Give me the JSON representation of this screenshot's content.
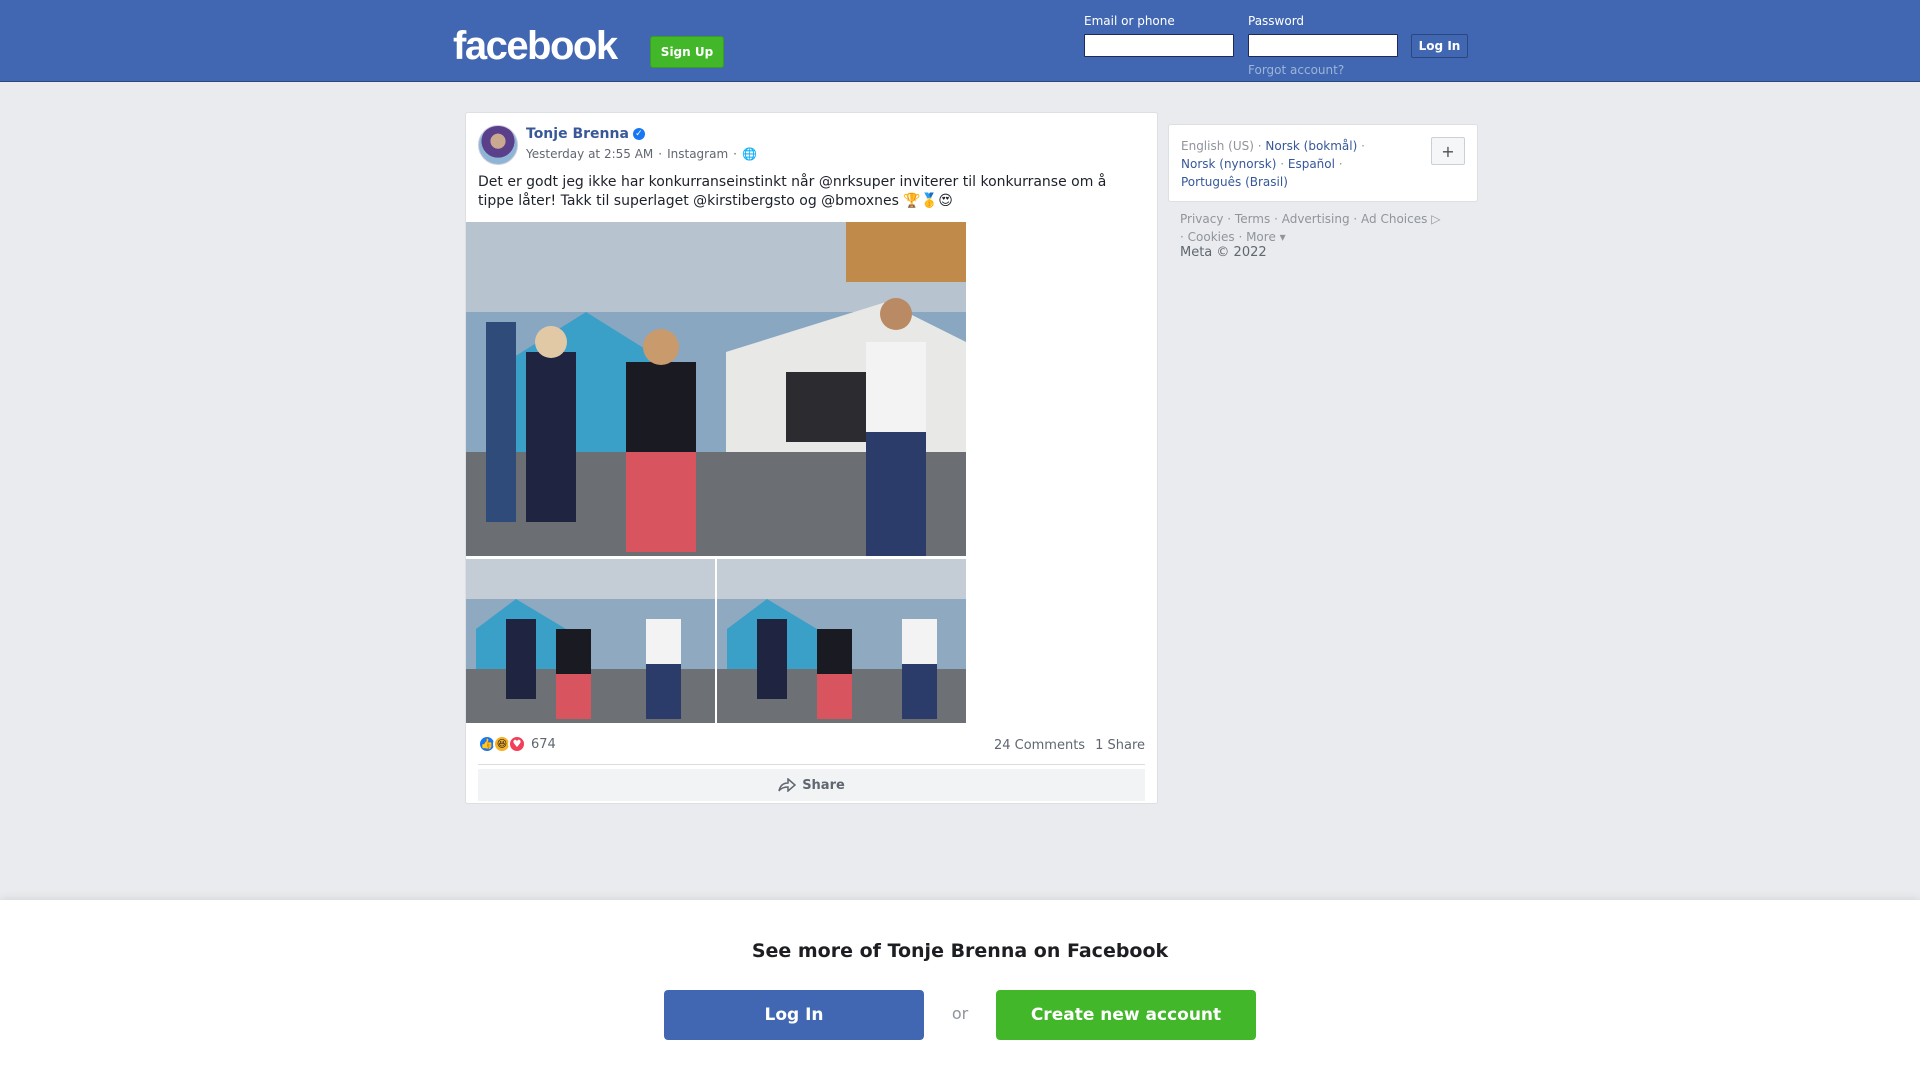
{
  "header": {
    "logo": "facebook",
    "signup_label": "Sign Up",
    "email_label": "Email or phone",
    "password_label": "Password",
    "login_label": "Log In",
    "forgot_label": "Forgot account?"
  },
  "post": {
    "author": "Tonje Brenna",
    "timestamp": "Yesterday at 2:55 AM",
    "source": "Instagram",
    "text": "Det er godt jeg ikke har konkurranseinstinkt når @nrksuper inviterer til konkurranse om å tippe låter! Takk til superlaget @kirstibergsto og @bmoxnes 🏆🥇😍",
    "reactions_count": "674",
    "comments": "24 Comments",
    "shares": "1 Share",
    "share_label": "Share",
    "icons": [
      "avatar",
      "verified-badge-icon",
      "globe-icon",
      "like-reaction-icon",
      "haha-reaction-icon",
      "love-reaction-icon",
      "share-arrow-icon"
    ]
  },
  "sidebar": {
    "languages": {
      "current": "English (US)",
      "norsk_bokmal": "Norsk (bokmål)",
      "norsk_nynorsk": "Norsk (nynorsk)",
      "espanol": "Español",
      "portugues": "Português (Brasil)",
      "more_button": "+"
    },
    "footer": {
      "privacy": "Privacy",
      "terms": "Terms",
      "advertising": "Advertising",
      "ad_choices": "Ad Choices",
      "cookies": "Cookies",
      "more": "More",
      "copyright": "Meta © 2022"
    }
  },
  "bottom": {
    "title": "See more of Tonje Brenna on Facebook",
    "login_label": "Log In",
    "or": "or",
    "create_label": "Create new account"
  },
  "colors": {
    "brand_blue": "#4267b2",
    "green": "#42b72a",
    "link": "#385898",
    "background": "#e9ebee"
  }
}
